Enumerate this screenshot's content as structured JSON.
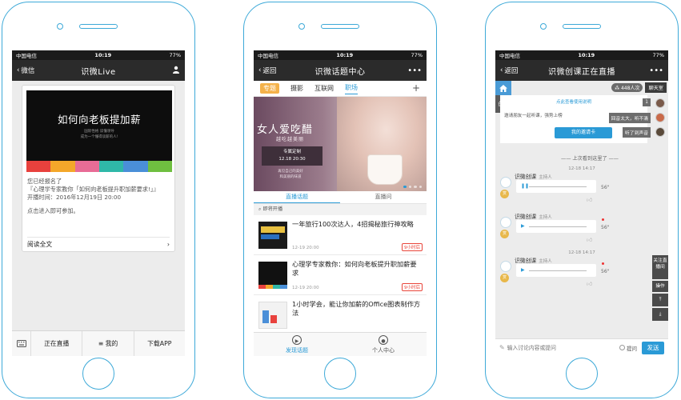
{
  "status": {
    "carrier": "中国电信",
    "time": "10:19",
    "battery": "77%"
  },
  "colors": {
    "accent": "#2a9ad6",
    "phone_outline": "#3da9d8",
    "hot_tag": "#f4b24a",
    "badge_red": "#e9453a"
  },
  "phone1": {
    "back_label": "微信",
    "title": "识微Live",
    "cover": {
      "title": "如何向老板提加薪",
      "subtitle_line1": "国际性格 读懂领导",
      "subtitle_line2": "成为一个懂得谈薪的人!",
      "strip_colors": [
        "#e8413d",
        "#f4a72a",
        "#e86c96",
        "#2fb8a8",
        "#4a8fd8",
        "#6fbf40"
      ]
    },
    "info": {
      "line1": "您已经报名了",
      "line2": "『心理学专家教你「如何向老板提升职加薪要求!」』",
      "line3": "开播时间：2016年12月19日 20:00",
      "line4": "点击进入即可参加。"
    },
    "read_more": "阅读全文",
    "tabs": [
      "正在直播",
      "≡ 我的",
      "下载APP"
    ]
  },
  "phone2": {
    "back_label": "返回",
    "title": "识微话题中心",
    "more": "•••",
    "categories": [
      "专题",
      "摄影",
      "互联网",
      "职场"
    ],
    "banner": {
      "title": "女人爱吃醋",
      "subtitle": "越吃越美丽",
      "tag_line1": "专属定制",
      "tag_line2": "12.18 20:30",
      "note_line1": "再见自己的美好",
      "note_line2": "和美丽的味道"
    },
    "subtabs": [
      "直播话题",
      "直播问"
    ],
    "section": "即将开播",
    "items": [
      {
        "title": "一年旅行100次达人，4招揭秘旅行神攻略",
        "meta": "12-19 20:00",
        "badge": "9小时后"
      },
      {
        "title": "心理学专家教你：如何向老板提升职加薪要求",
        "meta": "12-19 20:00",
        "badge": "9小时后"
      },
      {
        "title": "1小时学会，能让你加薪的Office图表制作方法",
        "meta": "",
        "badge": ""
      }
    ],
    "tabbar": [
      "发现话题",
      "个人中心"
    ]
  },
  "phone3": {
    "back_label": "返回",
    "title": "识微创课正在直播",
    "more": "•••",
    "side_create": "创建",
    "people": "448人次",
    "chatroom": "聊天室",
    "invite": {
      "link": "点此查看使用说明",
      "text": "邀请朋友一起听课，强势上榜",
      "button": "我的邀请卡"
    },
    "bubbles": [
      "1",
      "回音太大，听不清",
      "听了到声音"
    ],
    "divider": "上次看到这里了",
    "messages": [
      {
        "time": "12-18 14:17",
        "name": "识微创课",
        "role": "主持人",
        "duration": "56\""
      },
      {
        "time": "",
        "name": "识微创课",
        "role": "主持人",
        "duration": "56\""
      },
      {
        "time": "12-18 14:17",
        "name": "识微创课",
        "role": "主持人",
        "duration": "56\""
      }
    ],
    "right_panel": {
      "follow": "关注直播间",
      "ops": "操作"
    },
    "input": {
      "placeholder": "输入讨论内容或提问",
      "ask": "提问",
      "send": "发送"
    }
  }
}
